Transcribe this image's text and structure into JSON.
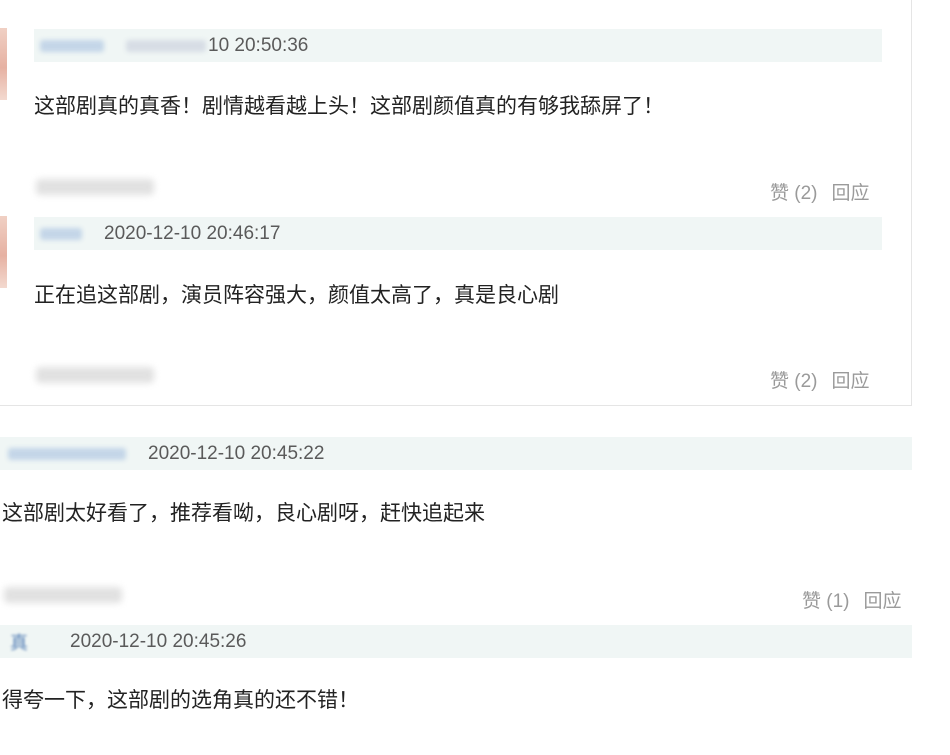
{
  "comments": [
    {
      "time": "10 20:50:36",
      "text": "这部剧真的真香！剧情越看越上头！这部剧颜值真的有够我舔屏了！",
      "like_label": "赞 (2)",
      "reply_label": "回应"
    },
    {
      "time": "2020-12-10 20:46:17",
      "text": "正在追这部剧，演员阵容强大，颜值太高了，真是良心剧",
      "like_label": "赞 (2)",
      "reply_label": "回应"
    },
    {
      "time": "2020-12-10 20:45:22",
      "text": "这部剧太好看了，推荐看呦，良心剧呀，赶快追起来",
      "like_label": "赞 (1)",
      "reply_label": "回应"
    },
    {
      "name_fragment": "真",
      "time": "2020-12-10 20:45:26",
      "text": "得夸一下，这部剧的选角真的还不错！"
    }
  ],
  "colors": {
    "meta_bar": "#f0f6f5",
    "action_text": "#9a9a9a",
    "body_text": "#222222",
    "timestamp": "#5a5a5a"
  }
}
